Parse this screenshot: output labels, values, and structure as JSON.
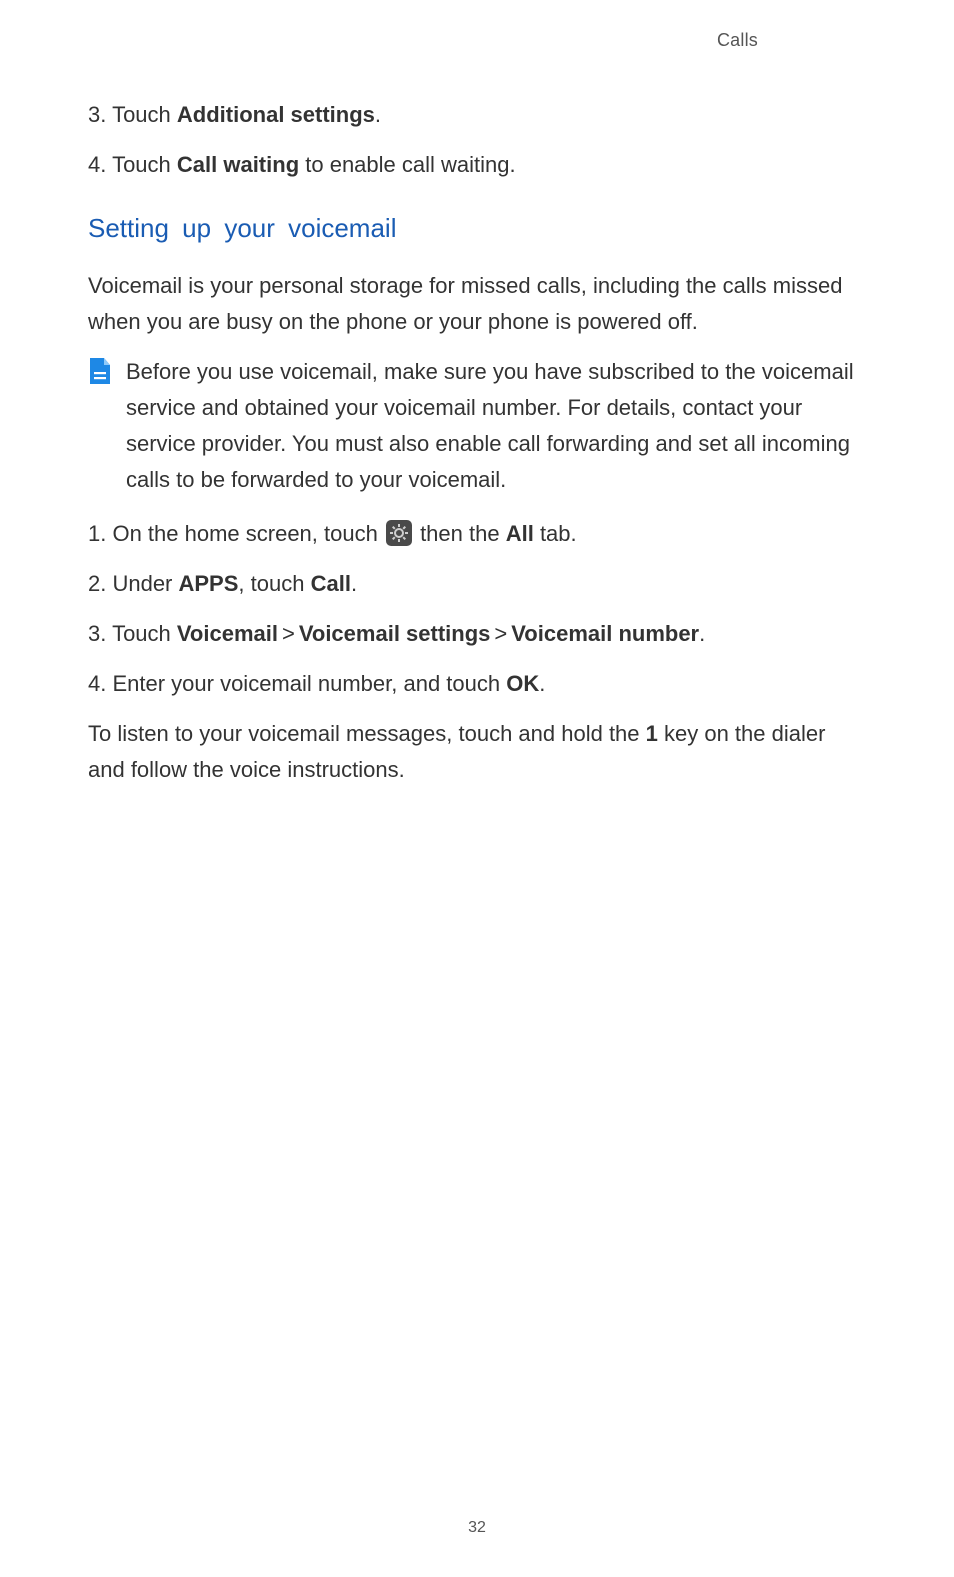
{
  "header": {
    "section": "Calls"
  },
  "steps_top": {
    "s3_pre": "3. Touch ",
    "s3_bold": "Additional settings",
    "s3_post": ".",
    "s4_pre": "4. Touch ",
    "s4_bold": "Call waiting",
    "s4_post": " to enable call waiting."
  },
  "heading": "Setting up your voicemail",
  "intro": "Voicemail is your personal storage for missed calls, including the calls missed when you are busy on the phone or your phone is powered off.",
  "note": "Before you use voicemail, make sure you have subscribed to the voicemail service and obtained your voicemail number. For details, contact your service provider. You must also enable call forwarding and set all incoming calls to be forwarded to your voicemail.",
  "steps_num": {
    "s1_pre": "1. On the home screen, touch ",
    "s1_mid": " then the ",
    "s1_bold": "All",
    "s1_post": " tab.",
    "s2_pre": "2. Under ",
    "s2_bold1": "APPS",
    "s2_mid": ", touch ",
    "s2_bold2": "Call",
    "s2_post": ".",
    "s3_pre": "3. Touch ",
    "s3_b1": "Voicemail",
    "s3_gt1": ">",
    "s3_b2": "Voicemail settings",
    "s3_gt2": ">",
    "s3_b3": "Voicemail number",
    "s3_post": ".",
    "s4_pre": "4. Enter your voicemail number, and touch ",
    "s4_bold": "OK",
    "s4_post": "."
  },
  "closing_pre": "To listen to your voicemail messages, touch and hold the ",
  "closing_bold": "1",
  "closing_post": " key on the dialer and follow the voice instructions.",
  "page_number": "32"
}
